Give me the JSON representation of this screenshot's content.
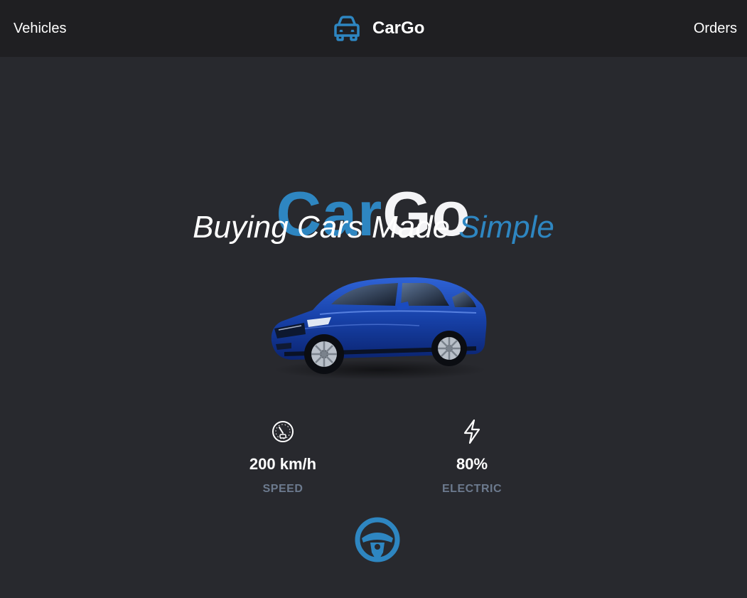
{
  "nav": {
    "vehicles_label": "Vehicles",
    "orders_label": "Orders",
    "brand_name": "CarGo",
    "brand_icon": "car-front-icon"
  },
  "hero": {
    "title_part1": "Car",
    "title_part2": "Go",
    "tagline_main": "Buying Cars Made ",
    "tagline_accent": "Simple",
    "car_image": "blue-suv-image"
  },
  "stats": [
    {
      "icon": "speedometer-icon",
      "value": "200 km/h",
      "label": "SPEED"
    },
    {
      "icon": "lightning-bolt-icon",
      "value": "80%",
      "label": "ELECTRIC"
    }
  ],
  "action": {
    "icon": "steering-wheel-icon"
  },
  "colors": {
    "accent": "#2e86c1",
    "background": "#28292e",
    "topbar": "#1f1f22",
    "muted_label": "#6c7a8e"
  }
}
